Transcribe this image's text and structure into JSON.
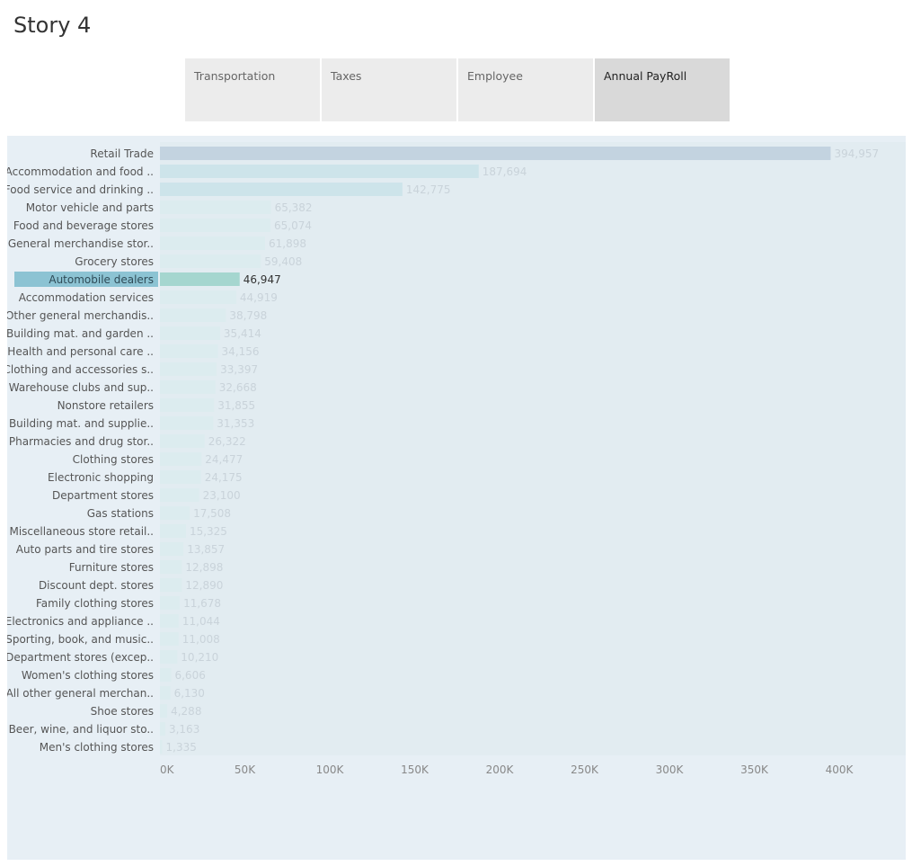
{
  "page": {
    "title": "Story 4"
  },
  "tabs": [
    {
      "label": "Transportation",
      "active": false
    },
    {
      "label": "Taxes",
      "active": false
    },
    {
      "label": "Employee",
      "active": false
    },
    {
      "label": "Annual PayRoll",
      "active": true
    }
  ],
  "colors": {
    "bar_top": "#c3d3e0",
    "bar_high": "#cde4ea",
    "bar_low": "#dcecef",
    "bar_selected": "#a5d6cf",
    "label_selected_bg": "#8cc3d3",
    "value_text": "#c9d3da",
    "label_text": "#555555"
  },
  "chart_data": {
    "type": "bar",
    "orientation": "horizontal",
    "selected": "Automobile dealers",
    "categories": [
      "Retail Trade",
      "Accommodation and food ..",
      "Food service and drinking ..",
      "Motor vehicle and parts",
      "Food and beverage stores",
      "General merchandise stor..",
      "Grocery stores",
      "Automobile dealers",
      "Accommodation services",
      "Other general merchandis..",
      "Building mat. and garden ..",
      "Health and personal care ..",
      "Clothing and accessories s..",
      "Warehouse clubs and sup..",
      "Nonstore retailers",
      "Building mat. and supplie..",
      "Pharmacies and drug stor..",
      "Clothing stores",
      "Electronic shopping",
      "Department stores",
      "Gas stations",
      "Miscellaneous store retail..",
      "Auto parts and tire stores",
      "Furniture stores",
      "Discount dept. stores",
      "Family clothing stores",
      "Electronics and appliance ..",
      "Sporting, book, and  music..",
      "Department stores (excep..",
      "Women's clothing stores",
      "All other general merchan..",
      "Shoe stores",
      "Beer, wine, and liquor sto..",
      "Men's clothing stores"
    ],
    "values": [
      394957,
      187694,
      142775,
      65382,
      65074,
      61898,
      59408,
      46947,
      44919,
      38798,
      35414,
      34156,
      33397,
      32668,
      31855,
      31353,
      26322,
      24477,
      24175,
      23100,
      17508,
      15325,
      13857,
      12898,
      12890,
      11678,
      11044,
      11008,
      10210,
      6606,
      6130,
      4288,
      3163,
      1335
    ],
    "value_labels": [
      "394,957",
      "187,694",
      "142,775",
      "65,382",
      "65,074",
      "61,898",
      "59,408",
      "46,947",
      "44,919",
      "38,798",
      "35,414",
      "34,156",
      "33,397",
      "32,668",
      "31,855",
      "31,353",
      "26,322",
      "24,477",
      "24,175",
      "23,100",
      "17,508",
      "15,325",
      "13,857",
      "12,898",
      "12,890",
      "11,678",
      "11,044",
      "11,008",
      "10,210",
      "6,606",
      "6,130",
      "4,288",
      "3,163",
      "1,335"
    ],
    "xlim": [
      0,
      440000
    ],
    "x_ticks": [
      0,
      50000,
      100000,
      150000,
      200000,
      250000,
      300000,
      350000,
      400000
    ],
    "x_tick_labels": [
      "0K",
      "50K",
      "100K",
      "150K",
      "200K",
      "250K",
      "300K",
      "350K",
      "400K"
    ],
    "grid": false,
    "xlabel": "",
    "ylabel": ""
  }
}
